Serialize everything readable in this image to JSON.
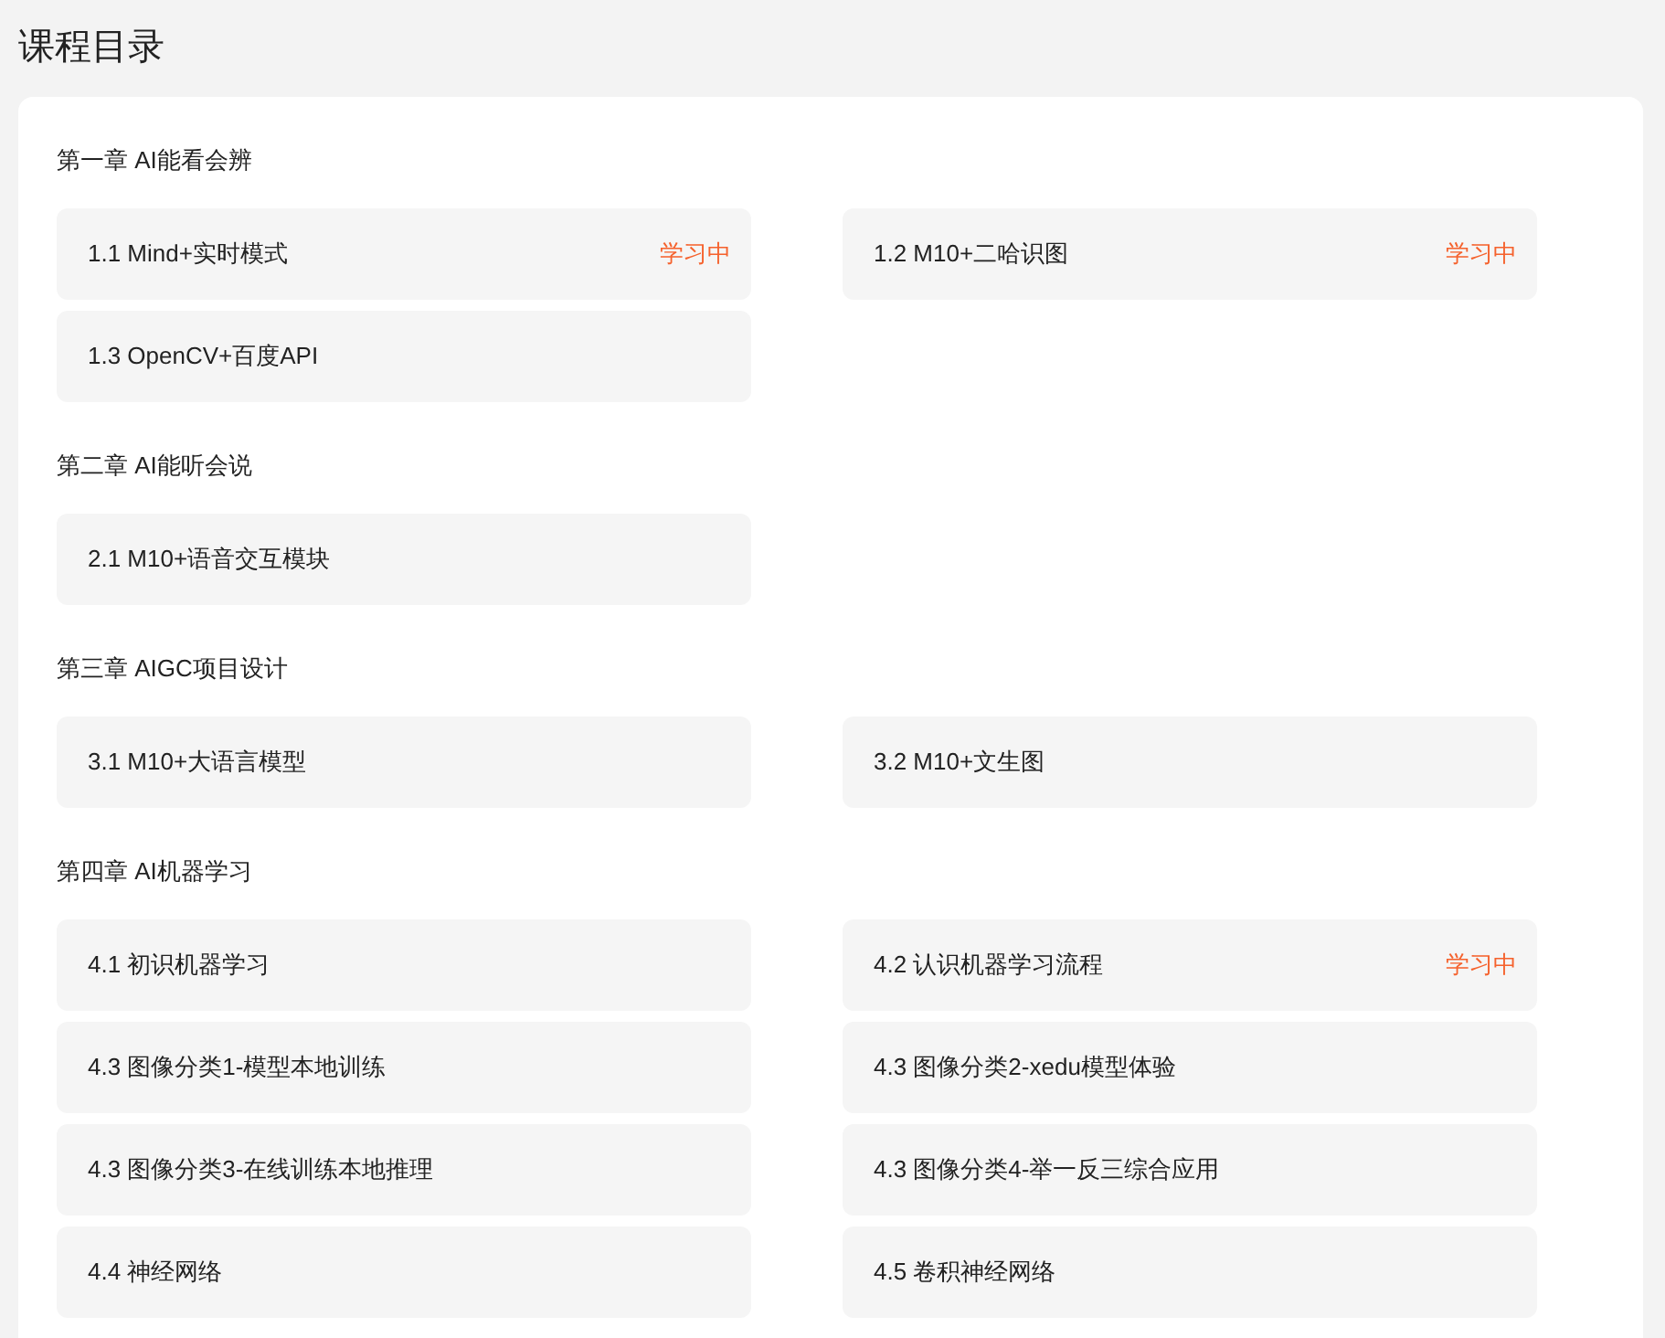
{
  "title": "课程目录",
  "chapters": [
    {
      "title": "第一章 AI能看会辨",
      "lessons": [
        {
          "title": "1.1 Mind+实时模式",
          "badge": "学习中"
        },
        {
          "title": "1.2 M10+二哈识图",
          "badge": "学习中"
        },
        {
          "title": "1.3 OpenCV+百度API"
        }
      ]
    },
    {
      "title": "第二章 AI能听会说",
      "lessons": [
        {
          "title": "2.1 M10+语音交互模块"
        }
      ]
    },
    {
      "title": "第三章 AIGC项目设计",
      "lessons": [
        {
          "title": "3.1 M10+大语言模型"
        },
        {
          "title": "3.2 M10+文生图"
        }
      ]
    },
    {
      "title": "第四章 AI机器学习",
      "lessons": [
        {
          "title": "4.1 初识机器学习"
        },
        {
          "title": "4.2 认识机器学习流程",
          "badge": "学习中"
        },
        {
          "title": "4.3 图像分类1-模型本地训练"
        },
        {
          "title": "4.3 图像分类2-xedu模型体验"
        },
        {
          "title": "4.3 图像分类3-在线训练本地推理"
        },
        {
          "title": "4.3 图像分类4-举一反三综合应用"
        },
        {
          "title": "4.4 神经网络"
        },
        {
          "title": "4.5 卷积神经网络"
        }
      ]
    }
  ]
}
